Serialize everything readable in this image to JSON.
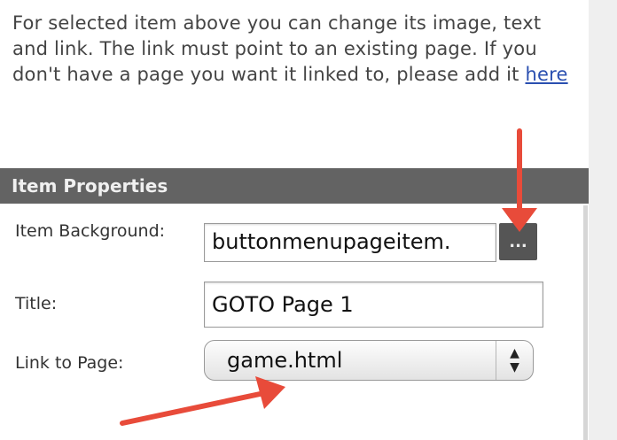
{
  "intro": {
    "text": "For selected item above you can change its image, text and link. The link must point to an existing page. If you don't have a page you want it linked to, please add it ",
    "link_label": "here"
  },
  "section": {
    "title": "Item Properties"
  },
  "form": {
    "background": {
      "label": "Item Background:",
      "value": "buttonmenupageitem.",
      "browse_label": "..."
    },
    "title": {
      "label": "Title:",
      "value": "GOTO Page 1"
    },
    "link": {
      "label": "Link to Page:",
      "value": "game.html"
    }
  },
  "annotations": {
    "arrow_color": "#e84b3a"
  },
  "icons": {
    "select_arrows": "up-down-chevron-icon"
  }
}
